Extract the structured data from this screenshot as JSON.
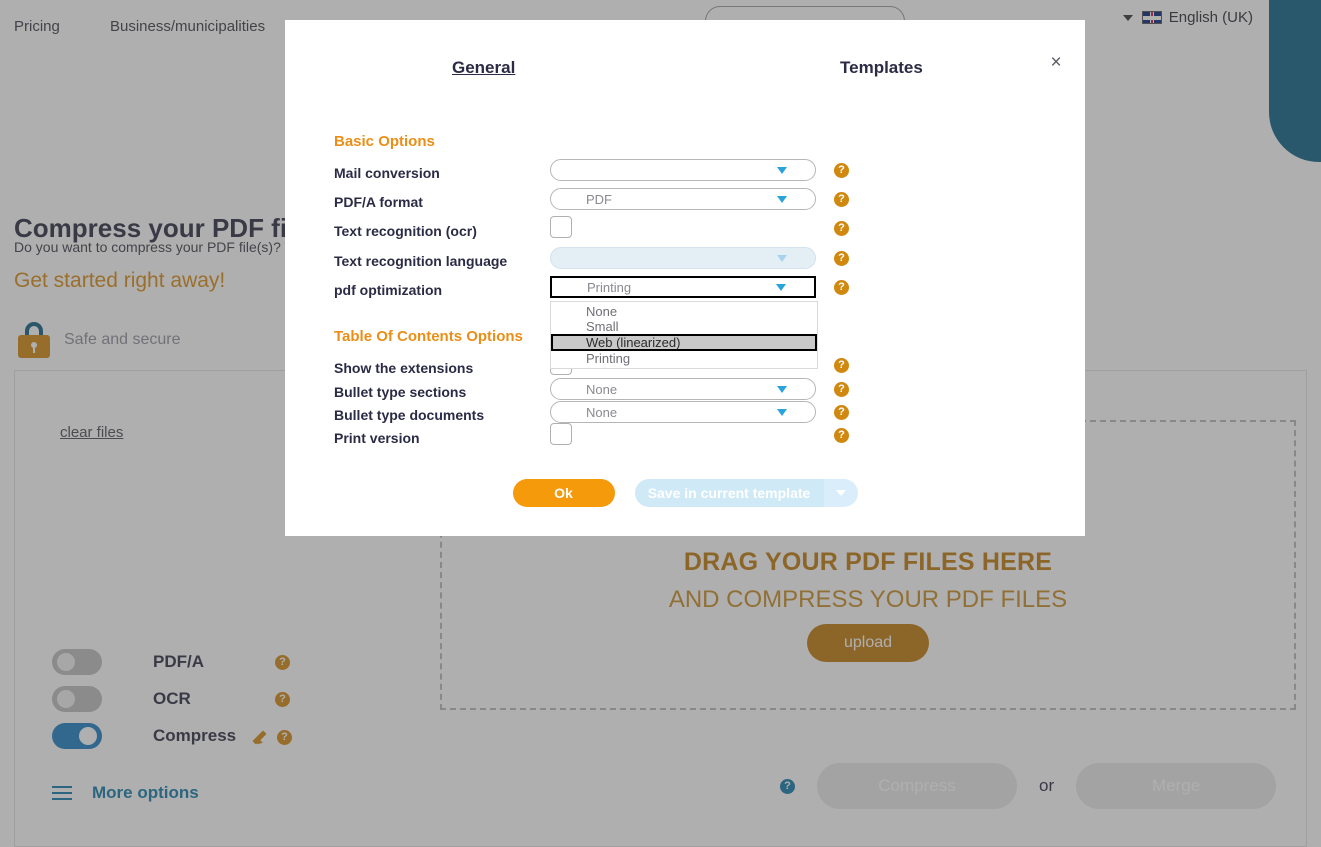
{
  "topnav": {
    "links": [
      {
        "label": "Pricing"
      },
      {
        "label": "Business/municipalities"
      }
    ],
    "language": "English (UK)",
    "search_placeholder": ""
  },
  "hero": {
    "title": "Compress your PDF files",
    "subtitle": "Do you want to compress your PDF file(s)? T                                                      PDF file(s).",
    "cta": "Get started right away!",
    "safe_and_secure": "Safe and secure"
  },
  "workspace": {
    "clear_files": "clear files",
    "dropzone_line1": "DRAG YOUR PDF FILES HERE",
    "dropzone_line2": "AND COMPRESS YOUR PDF FILES",
    "upload_button": "upload",
    "toggles": [
      {
        "label": "PDF/A",
        "state": "off"
      },
      {
        "label": "OCR",
        "state": "off"
      },
      {
        "label": "Compress",
        "state": "on"
      }
    ],
    "more_options": "More options",
    "compress_button": "Compress",
    "or_label": "or",
    "merge_button": "Merge",
    "help_icon": "help-icon"
  },
  "modal": {
    "close_icon": "×",
    "tabs": [
      {
        "label": "General",
        "active": true
      },
      {
        "label": "Templates",
        "active": false
      }
    ],
    "sections": [
      {
        "title": "Basic Options",
        "rows": [
          {
            "label": "Mail conversion",
            "type": "select",
            "value": "",
            "state": "normal"
          },
          {
            "label": "PDF/A format",
            "type": "select",
            "value": "PDF",
            "state": "normal"
          },
          {
            "label": "Text recognition (ocr)",
            "type": "checkbox",
            "checked": false
          },
          {
            "label": "Text recognition language",
            "type": "select",
            "value": "",
            "state": "disabled"
          },
          {
            "label": "pdf optimization",
            "type": "select",
            "value": "Printing",
            "state": "open"
          }
        ]
      },
      {
        "title": "Table Of Contents Options",
        "rows": [
          {
            "label": "Show the extensions",
            "type": "checkbox",
            "checked": false
          },
          {
            "label": "Bullet type sections",
            "type": "select",
            "value": "None",
            "state": "normal"
          },
          {
            "label": "Bullet type documents",
            "type": "select",
            "value": "None",
            "state": "normal"
          },
          {
            "label": "Print version",
            "type": "checkbox",
            "checked": false
          }
        ]
      }
    ],
    "pdf_optimization_options": [
      {
        "label": "None",
        "selected": false
      },
      {
        "label": "Small",
        "selected": false
      },
      {
        "label": "Web (linearized)",
        "selected": true
      },
      {
        "label": "Printing",
        "selected": false
      }
    ],
    "ok_button": "Ok",
    "save_button": "Save in current template",
    "save_caret_icon": "chevron-down-icon",
    "help_icon": "help-icon"
  },
  "colors": {
    "accent_orange": "#e98f17",
    "ok_orange": "#f59a0b",
    "toggle_blue": "#1c7fc4",
    "teal": "#0b5f85",
    "dark_navy": "#2b2b46"
  }
}
